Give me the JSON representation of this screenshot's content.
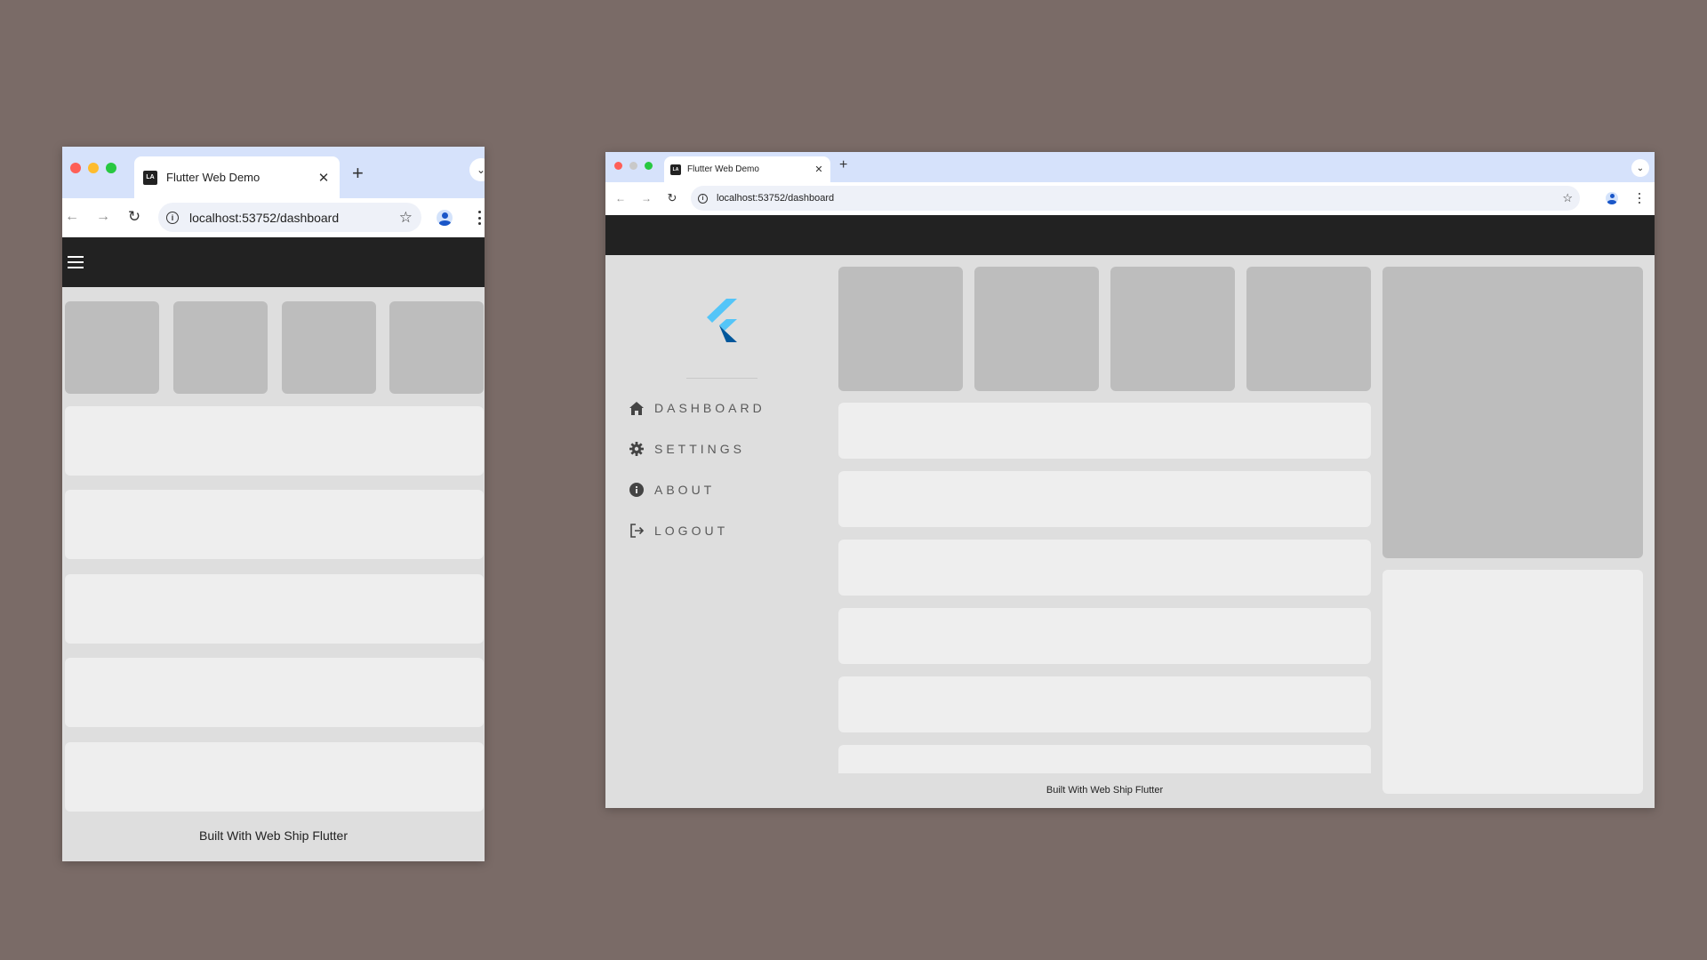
{
  "windows": {
    "small": {
      "tab_title": "Flutter Web Demo",
      "favicon_text": "LA",
      "url": "localhost:53752/dashboard",
      "footer": "Built With Web Ship Flutter"
    },
    "large": {
      "tab_title": "Flutter Web Demo",
      "favicon_text": "LA",
      "url": "localhost:53752/dashboard",
      "footer": "Built With Web Ship Flutter",
      "menu": [
        {
          "label": "DASHBOARD",
          "icon": "home-icon"
        },
        {
          "label": "SETTINGS",
          "icon": "gear-icon"
        },
        {
          "label": "ABOUT",
          "icon": "info-icon"
        },
        {
          "label": "LOGOUT",
          "icon": "logout-icon"
        }
      ]
    }
  },
  "colors": {
    "background": "#7a6b67",
    "app_bar": "#222222",
    "tab_strip": "#d6e2fb",
    "placeholder_dark": "#bdbdbd",
    "placeholder_light": "#eeeeee",
    "content_bg": "#dedede",
    "flutter_blue_light": "#54c5f8",
    "flutter_blue_dark": "#01579b"
  }
}
